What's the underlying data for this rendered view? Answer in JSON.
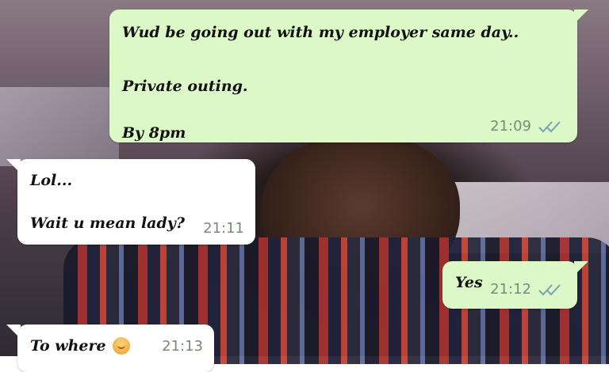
{
  "chat": {
    "messages": [
      {
        "direction": "outgoing",
        "lines": [
          "Wud be going out with my employer same day..",
          "Private outing.",
          "By 8pm"
        ],
        "time": "21:09",
        "status": "read-double-check-icon"
      },
      {
        "direction": "incoming",
        "lines": [
          "Lol...",
          "Wait u mean lady?"
        ],
        "time": "21:11"
      },
      {
        "direction": "outgoing",
        "lines": [
          "Yes"
        ],
        "time": "21:12",
        "status": "read-double-check-icon"
      },
      {
        "direction": "incoming",
        "lines": [
          "To where"
        ],
        "emoji": "person-tipping-hand-emoji",
        "time": "21:13"
      }
    ]
  },
  "colors": {
    "outgoing_bubble": "#dcf8c6",
    "incoming_bubble": "#ffffff",
    "meta_text": "#7a8a7a"
  }
}
